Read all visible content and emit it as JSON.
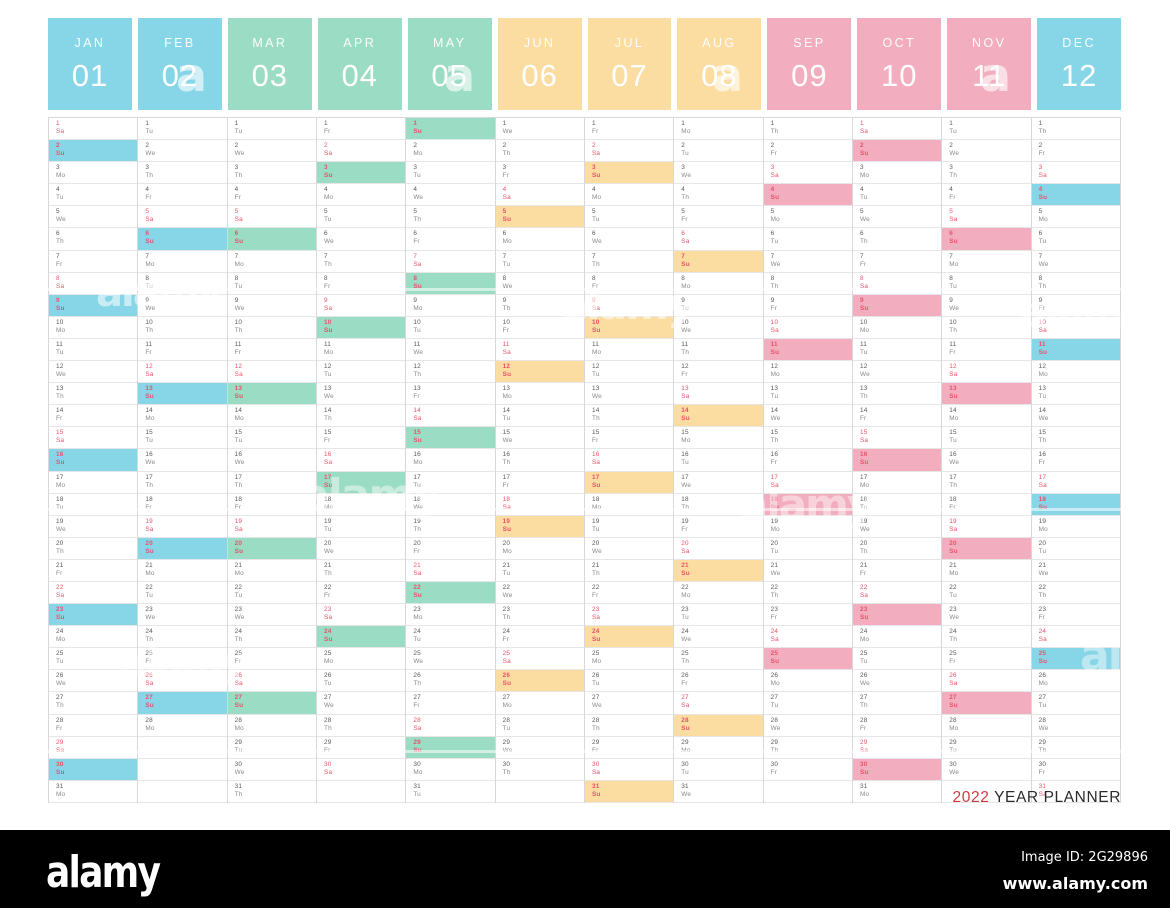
{
  "caption": {
    "year": "2022",
    "label": " YEAR PLANNER"
  },
  "colors": {
    "blue": "#87D6E8",
    "green": "#9BDCC4",
    "orange": "#FBDCA1",
    "pink": "#F2AEBE",
    "weekend_text": "#E8536B",
    "day_text": "#5A5A5A",
    "weekday_text": "#8A8A8A",
    "grid_line": "#D8D8D8",
    "caption_year": "#D4383F",
    "caption_label": "#2B2B2B",
    "alamy_bar": "#000000"
  },
  "watermark": {
    "alamy_letter": "a",
    "center_text": "alamy"
  },
  "alamy": {
    "logo": "alamy",
    "image_id": "Image ID: 2G29896",
    "url": "www.alamy.com"
  },
  "months": [
    {
      "abbr": "JAN",
      "num": "01",
      "color": "#87D6E8",
      "days": 31,
      "first_weekday": 6
    },
    {
      "abbr": "FEB",
      "num": "02",
      "color": "#87D6E8",
      "days": 28,
      "first_weekday": 2
    },
    {
      "abbr": "MAR",
      "num": "03",
      "color": "#9BDCC4",
      "days": 31,
      "first_weekday": 2
    },
    {
      "abbr": "APR",
      "num": "04",
      "color": "#9BDCC4",
      "days": 30,
      "first_weekday": 5
    },
    {
      "abbr": "MAY",
      "num": "05",
      "color": "#9BDCC4",
      "days": 31,
      "first_weekday": 7
    },
    {
      "abbr": "JUN",
      "num": "06",
      "color": "#FBDCA1",
      "days": 30,
      "first_weekday": 3
    },
    {
      "abbr": "JUL",
      "num": "07",
      "color": "#FBDCA1",
      "days": 31,
      "first_weekday": 5
    },
    {
      "abbr": "AUG",
      "num": "08",
      "color": "#FBDCA1",
      "days": 31,
      "first_weekday": 1
    },
    {
      "abbr": "SEP",
      "num": "09",
      "color": "#F2AEBE",
      "days": 30,
      "first_weekday": 4
    },
    {
      "abbr": "OCT",
      "num": "10",
      "color": "#F2AEBE",
      "days": 31,
      "first_weekday": 6
    },
    {
      "abbr": "NOV",
      "num": "11",
      "color": "#F2AEBE",
      "days": 30,
      "first_weekday": 2
    },
    {
      "abbr": "DEC",
      "num": "12",
      "color": "#87D6E8",
      "days": 31,
      "first_weekday": 4
    }
  ],
  "weekday_labels": [
    "Mo",
    "Tu",
    "We",
    "Th",
    "Fr",
    "Sa",
    "Su"
  ],
  "rows": 31
}
